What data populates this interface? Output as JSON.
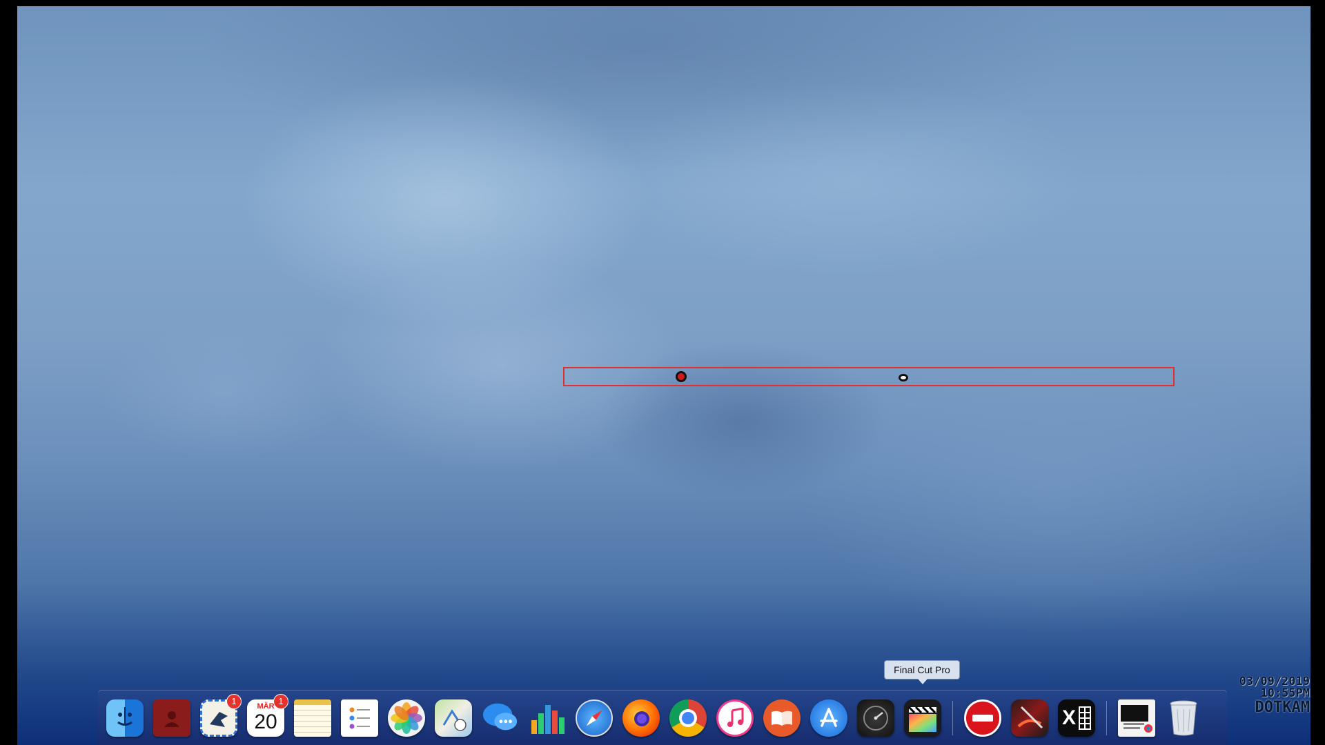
{
  "tooltip": {
    "label": "Final Cut Pro"
  },
  "timestamp": {
    "date": "03/09/2019",
    "time": "10:55PM",
    "camera": "DOTKAM"
  },
  "dock": {
    "apps": [
      {
        "name": "Finder",
        "icon": "finder-icon"
      },
      {
        "name": "Contacts",
        "icon": "contacts-icon"
      },
      {
        "name": "Mail",
        "icon": "mail-icon",
        "badge": "1"
      },
      {
        "name": "Calendar",
        "icon": "calendar-icon",
        "badge": "1",
        "month": "MÄR",
        "day": "20"
      },
      {
        "name": "Notes",
        "icon": "notes-icon"
      },
      {
        "name": "Reminders",
        "icon": "reminders-icon"
      },
      {
        "name": "Photos",
        "icon": "photos-icon"
      },
      {
        "name": "Maps",
        "icon": "maps-icon"
      },
      {
        "name": "Messages",
        "icon": "messages-icon"
      },
      {
        "name": "Numbers",
        "icon": "numbers-icon"
      },
      {
        "name": "Safari",
        "icon": "safari-icon"
      },
      {
        "name": "Firefox",
        "icon": "firefox-icon"
      },
      {
        "name": "Chrome",
        "icon": "chrome-icon"
      },
      {
        "name": "iTunes",
        "icon": "itunes-icon"
      },
      {
        "name": "Books",
        "icon": "books-icon"
      },
      {
        "name": "App Store",
        "icon": "app-store-icon"
      },
      {
        "name": "Dashboard",
        "icon": "dashboard-icon"
      },
      {
        "name": "Final Cut Pro",
        "icon": "final-cut-pro-icon"
      }
    ],
    "extras": [
      {
        "name": "Stop",
        "icon": "stop-icon"
      },
      {
        "name": "Photo Editor",
        "icon": "photo-editor-icon"
      },
      {
        "name": "Excel",
        "icon": "excel-icon",
        "glyph": "X"
      },
      {
        "name": "Screenshot Folder",
        "icon": "screenshot-stack-icon"
      },
      {
        "name": "Trash",
        "icon": "trash-icon"
      }
    ]
  }
}
